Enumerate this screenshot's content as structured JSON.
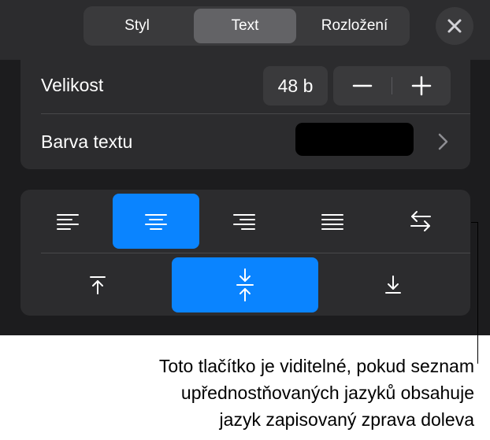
{
  "tabs": [
    {
      "label": "Styl",
      "active": false
    },
    {
      "label": "Text",
      "active": true
    },
    {
      "label": "Rozložení",
      "active": false
    }
  ],
  "close_icon": "close-icon",
  "size_row": {
    "label": "Velikost",
    "value": "48 b",
    "decrement_icon": "minus-icon",
    "increment_icon": "plus-icon"
  },
  "color_row": {
    "label": "Barva textu",
    "swatch_color": "#000000",
    "chevron_icon": "chevron-right-icon"
  },
  "alignment": {
    "horizontal": [
      {
        "icon": "align-left-icon",
        "selected": false
      },
      {
        "icon": "align-center-icon",
        "selected": true
      },
      {
        "icon": "align-right-icon",
        "selected": false
      },
      {
        "icon": "align-justify-icon",
        "selected": false
      },
      {
        "icon": "text-direction-icon",
        "selected": false
      }
    ],
    "vertical": [
      {
        "icon": "align-top-icon",
        "selected": false
      },
      {
        "icon": "align-middle-icon",
        "selected": true
      },
      {
        "icon": "align-bottom-icon",
        "selected": false
      }
    ]
  },
  "callout": {
    "line1": "Toto tlačítko je viditelné, pokud seznam",
    "line2": "upřednostňovaných jazyků obsahuje",
    "line3": "jazyk zapisovaný zprava doleva"
  },
  "colors": {
    "accent": "#0a84ff",
    "panel_bg": "#1c1c1e",
    "card_bg": "#2c2c2e"
  }
}
